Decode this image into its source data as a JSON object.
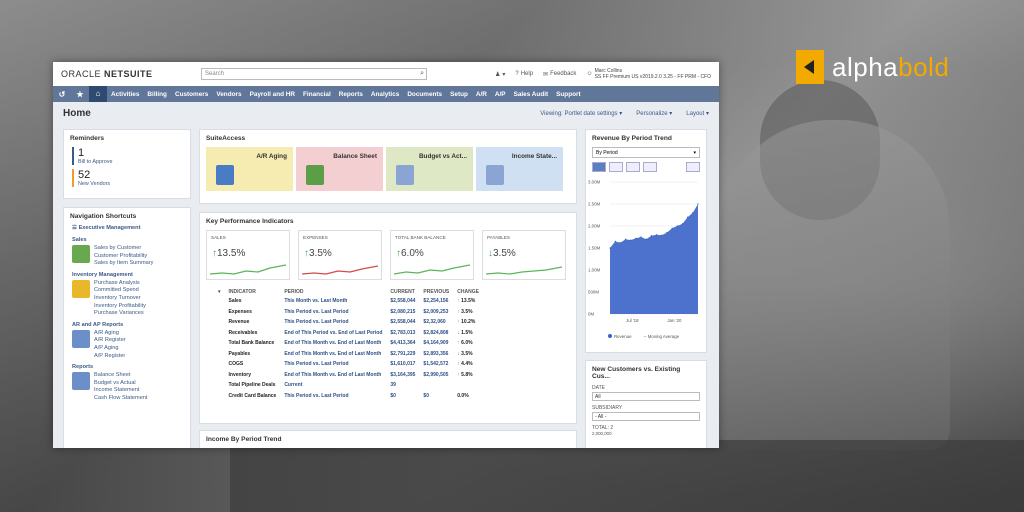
{
  "brand": {
    "name": "alphabold",
    "part1": "alpha",
    "part2": "bold",
    "mark_color": "#f2a900"
  },
  "app": {
    "logo": "ORACLE NETSUITE",
    "logo_oracle": "ORACLE",
    "logo_netsuite": "NETSUITE",
    "search_placeholder": "Search",
    "help": "Help",
    "feedback": "Feedback",
    "user_name": "Marc Collins",
    "user_role": "SS FF Premium US v2019.2.0 3.25 - FF PRM - CFO"
  },
  "nav": {
    "items": [
      "Activities",
      "Billing",
      "Customers",
      "Vendors",
      "Payroll and HR",
      "Financial",
      "Reports",
      "Analytics",
      "Documents",
      "Setup",
      "A/R",
      "A/P",
      "Sales Audit",
      "Support"
    ]
  },
  "page": {
    "title": "Home",
    "viewing": "Viewing: Portlet date settings",
    "personalize": "Personalize",
    "layout": "Layout"
  },
  "reminders": {
    "title": "Reminders",
    "items": [
      {
        "count": "1",
        "label": "Bill to Approve"
      },
      {
        "count": "52",
        "label": "New Vendors"
      }
    ]
  },
  "nav_shortcuts": {
    "title": "Navigation Shortcuts",
    "exec": "Executive Management",
    "groups": [
      {
        "title": "Sales",
        "links": [
          "Sales by Customer",
          "Customer Profitability",
          "Sales by Item Summary"
        ]
      },
      {
        "title": "Inventory Management",
        "links": [
          "Purchase Analysis",
          "Committed Spend",
          "Inventory Turnover",
          "Inventory Profitability",
          "Purchase Variances"
        ]
      },
      {
        "title": "AR and AP Reports",
        "links": [
          "A/R Aging",
          "A/R Register",
          "A/P Aging",
          "A/P Register"
        ]
      },
      {
        "title": "Reports",
        "links": [
          "Balance Sheet",
          "Budget vs Actual",
          "Income Statement",
          "Cash Flow Statement"
        ]
      }
    ]
  },
  "suite_access": {
    "title": "SuiteAccess",
    "tiles": [
      {
        "label": "A/R Aging",
        "color": "#f6ebb0"
      },
      {
        "label": "Balance Sheet",
        "color": "#f4cfd2"
      },
      {
        "label": "Budget vs Act...",
        "color": "#dfe8c4"
      },
      {
        "label": "Income State...",
        "color": "#cfe0f2"
      }
    ]
  },
  "kpi": {
    "title": "Key Performance Indicators",
    "cards": [
      {
        "label": "SALES",
        "value": "13.5%",
        "dir": "up",
        "color": "#5ab55a"
      },
      {
        "label": "EXPENSES",
        "value": "3.5%",
        "dir": "up",
        "color": "#d14a4a"
      },
      {
        "label": "TOTAL BANK BALANCE",
        "value": "6.0%",
        "dir": "up",
        "color": "#5ab55a"
      },
      {
        "label": "PAYABLES",
        "value": "3.5%",
        "dir": "down",
        "color": "#5ab55a"
      }
    ],
    "headers": [
      "INDICATOR",
      "PERIOD",
      "CURRENT",
      "PREVIOUS",
      "CHANGE"
    ],
    "rows": [
      [
        "Sales",
        "This Month vs. Last Month",
        "$2,558,044",
        "$2,254,156",
        "13.5%",
        "up"
      ],
      [
        "Expenses",
        "This Period vs. Last Period",
        "$2,080,215",
        "$2,009,253",
        "3.5%",
        "up"
      ],
      [
        "Revenue",
        "This Period vs. Last Period",
        "$2,558,044",
        "$2,32,060",
        "10.2%",
        "up"
      ],
      [
        "Receivables",
        "End of This Period vs. End of Last Period",
        "$2,783,013",
        "$2,824,808",
        "1.5%",
        "down"
      ],
      [
        "Total Bank Balance",
        "End of This Month vs. End of Last Month",
        "$4,413,364",
        "$4,164,909",
        "6.0%",
        "up"
      ],
      [
        "Payables",
        "End of This Month vs. End of Last Month",
        "$2,791,229",
        "$2,893,356",
        "3.5%",
        "down"
      ],
      [
        "COGS",
        "This Period vs. Last Period",
        "$1,610,017",
        "$1,542,572",
        "4.4%",
        "up"
      ],
      [
        "Inventory",
        "End of This Month vs. End of Last Month",
        "$3,164,395",
        "$2,990,505",
        "5.8%",
        "up"
      ],
      [
        "Total Pipeline Deals",
        "Current",
        "39",
        "",
        "",
        " "
      ],
      [
        "Credit Card Balance",
        "This Period vs. Last Period",
        "$0",
        "$0",
        "0.0%",
        " "
      ]
    ]
  },
  "income_trend": {
    "title": "Income By Period Trend"
  },
  "revenue_trend": {
    "title": "Revenue By Period Trend",
    "select": "By Period",
    "legend_revenue": "Revenue",
    "legend_ma": "Moving Average"
  },
  "chart_data": {
    "type": "area",
    "title": "Revenue By Period Trend",
    "yticks": [
      "3.00M",
      "2.50M",
      "2.00M",
      "1.50M",
      "1.00M",
      "500M",
      "0M"
    ],
    "ylim": [
      0,
      3000000
    ],
    "xticks": [
      "Jul '18",
      "Jan '20"
    ],
    "series": [
      {
        "name": "Revenue",
        "values": [
          1500000,
          1650000,
          1620000,
          1700000,
          1680000,
          1720000,
          1750000,
          1700000,
          1780000,
          1800000,
          1790000,
          1850000,
          1950000,
          2000000,
          2050000,
          2200000,
          2300000,
          2500000
        ]
      }
    ],
    "color": "#3a63c9"
  },
  "cust_compare": {
    "title": "New Customers vs. Existing Cus...",
    "date_label": "DATE",
    "date_value": "All",
    "subsidiary_label": "SUBSIDIARY",
    "subsidiary_value": "- All -",
    "total_label": "TOTAL: 2",
    "total_tick": "2,000,000"
  }
}
